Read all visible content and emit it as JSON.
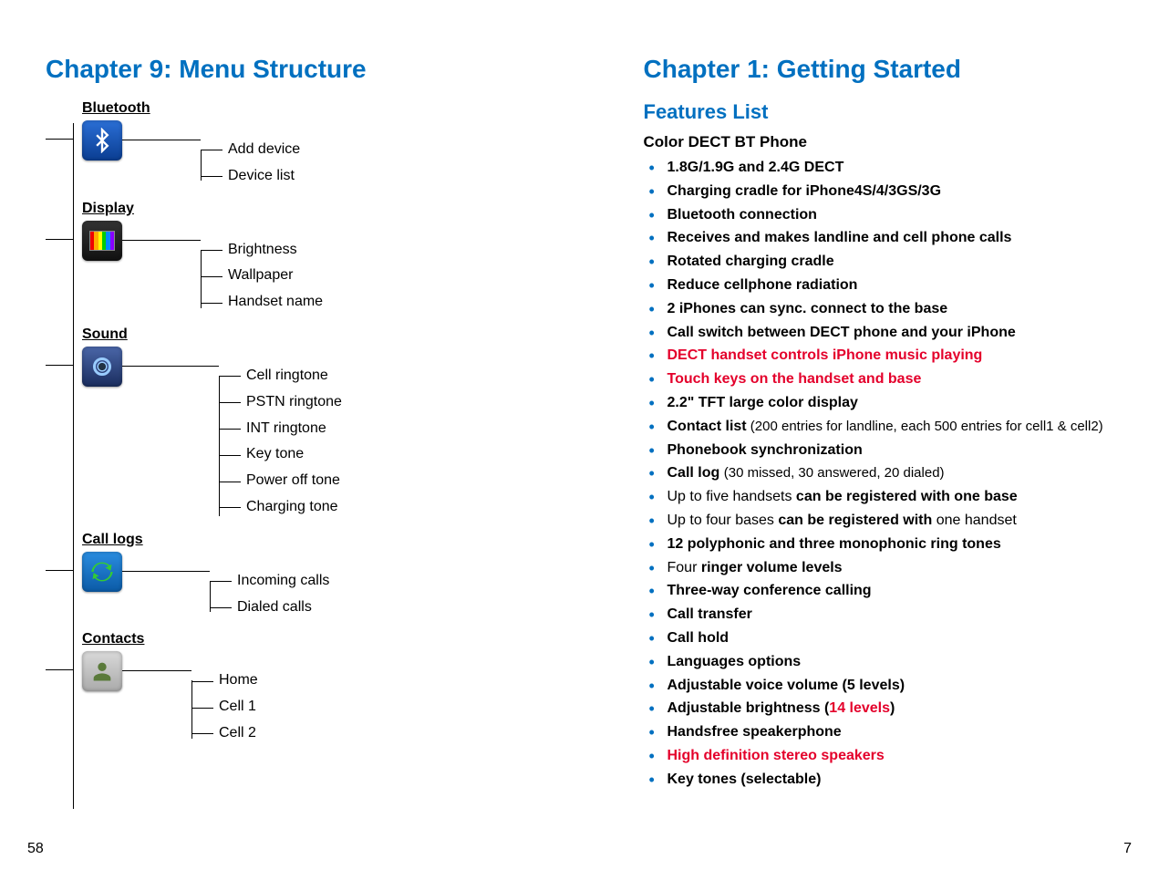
{
  "left": {
    "chapter_title": "Chapter 9: Menu Structure",
    "page_number": "58",
    "menu": [
      {
        "key": "bluetooth",
        "label": "Bluetooth",
        "items": [
          "Add device",
          "Device list"
        ]
      },
      {
        "key": "display",
        "label": "Display",
        "items": [
          "Brightness",
          "Wallpaper",
          "Handset name"
        ]
      },
      {
        "key": "sound",
        "label": "Sound",
        "items": [
          "Cell ringtone",
          "PSTN ringtone",
          "INT ringtone",
          "Key tone",
          "Power off tone",
          "Charging tone"
        ]
      },
      {
        "key": "calllogs",
        "label": "Call logs",
        "items": [
          "Incoming calls",
          "Dialed calls"
        ]
      },
      {
        "key": "contacts",
        "label": "Contacts",
        "items": [
          "Home",
          "Cell 1",
          "Cell 2"
        ]
      }
    ]
  },
  "right": {
    "chapter_title": "Chapter 1: Getting Started",
    "section_title": "Features List",
    "product_name": "Color DECT BT Phone",
    "page_number": "7",
    "features": {
      "f0": "1.8G/1.9G and 2.4G DECT",
      "f1": "Charging cradle for iPhone4S/4/3GS/3G",
      "f2": "Bluetooth connection",
      "f3": "Receives and makes landline and cell phone calls",
      "f4": "Rotated charging cradle",
      "f5": "Reduce cellphone radiation",
      "f6": "2 iPhones can sync. connect to the base",
      "f7": "Call switch between DECT phone and your iPhone",
      "f8": "DECT handset controls iPhone music playing",
      "f9": "Touch keys on the handset and base",
      "f10": "2.2\" TFT large color display",
      "f11a": "Contact list",
      "f11b": " (200 entries for landline, each 500 entries for cell1 & cell2)",
      "f12": "Phonebook synchronization",
      "f13a": "Call log ",
      "f13b": "(30 missed, 30 answered, 20 dialed)",
      "f14a": "Up to five handsets ",
      "f14b": "can be registered with one base",
      "f15a": "Up to four bases ",
      "f15b": "can be registered with",
      "f15c": " one handset",
      "f16": "12 polyphonic and three monophonic ring tones",
      "f17a": "Four ",
      "f17b": "ringer volume levels",
      "f18": "Three-way conference calling",
      "f19": "Call transfer",
      "f20": "Call hold",
      "f21": "Languages options",
      "f22": "Adjustable voice volume (5 levels)",
      "f23a": "Adjustable brightness (",
      "f23b": "14 levels",
      "f23c": ")",
      "f24": "Handsfree speakerphone",
      "f25": "High definition stereo speakers",
      "f26": "Key tones (selectable)"
    }
  }
}
